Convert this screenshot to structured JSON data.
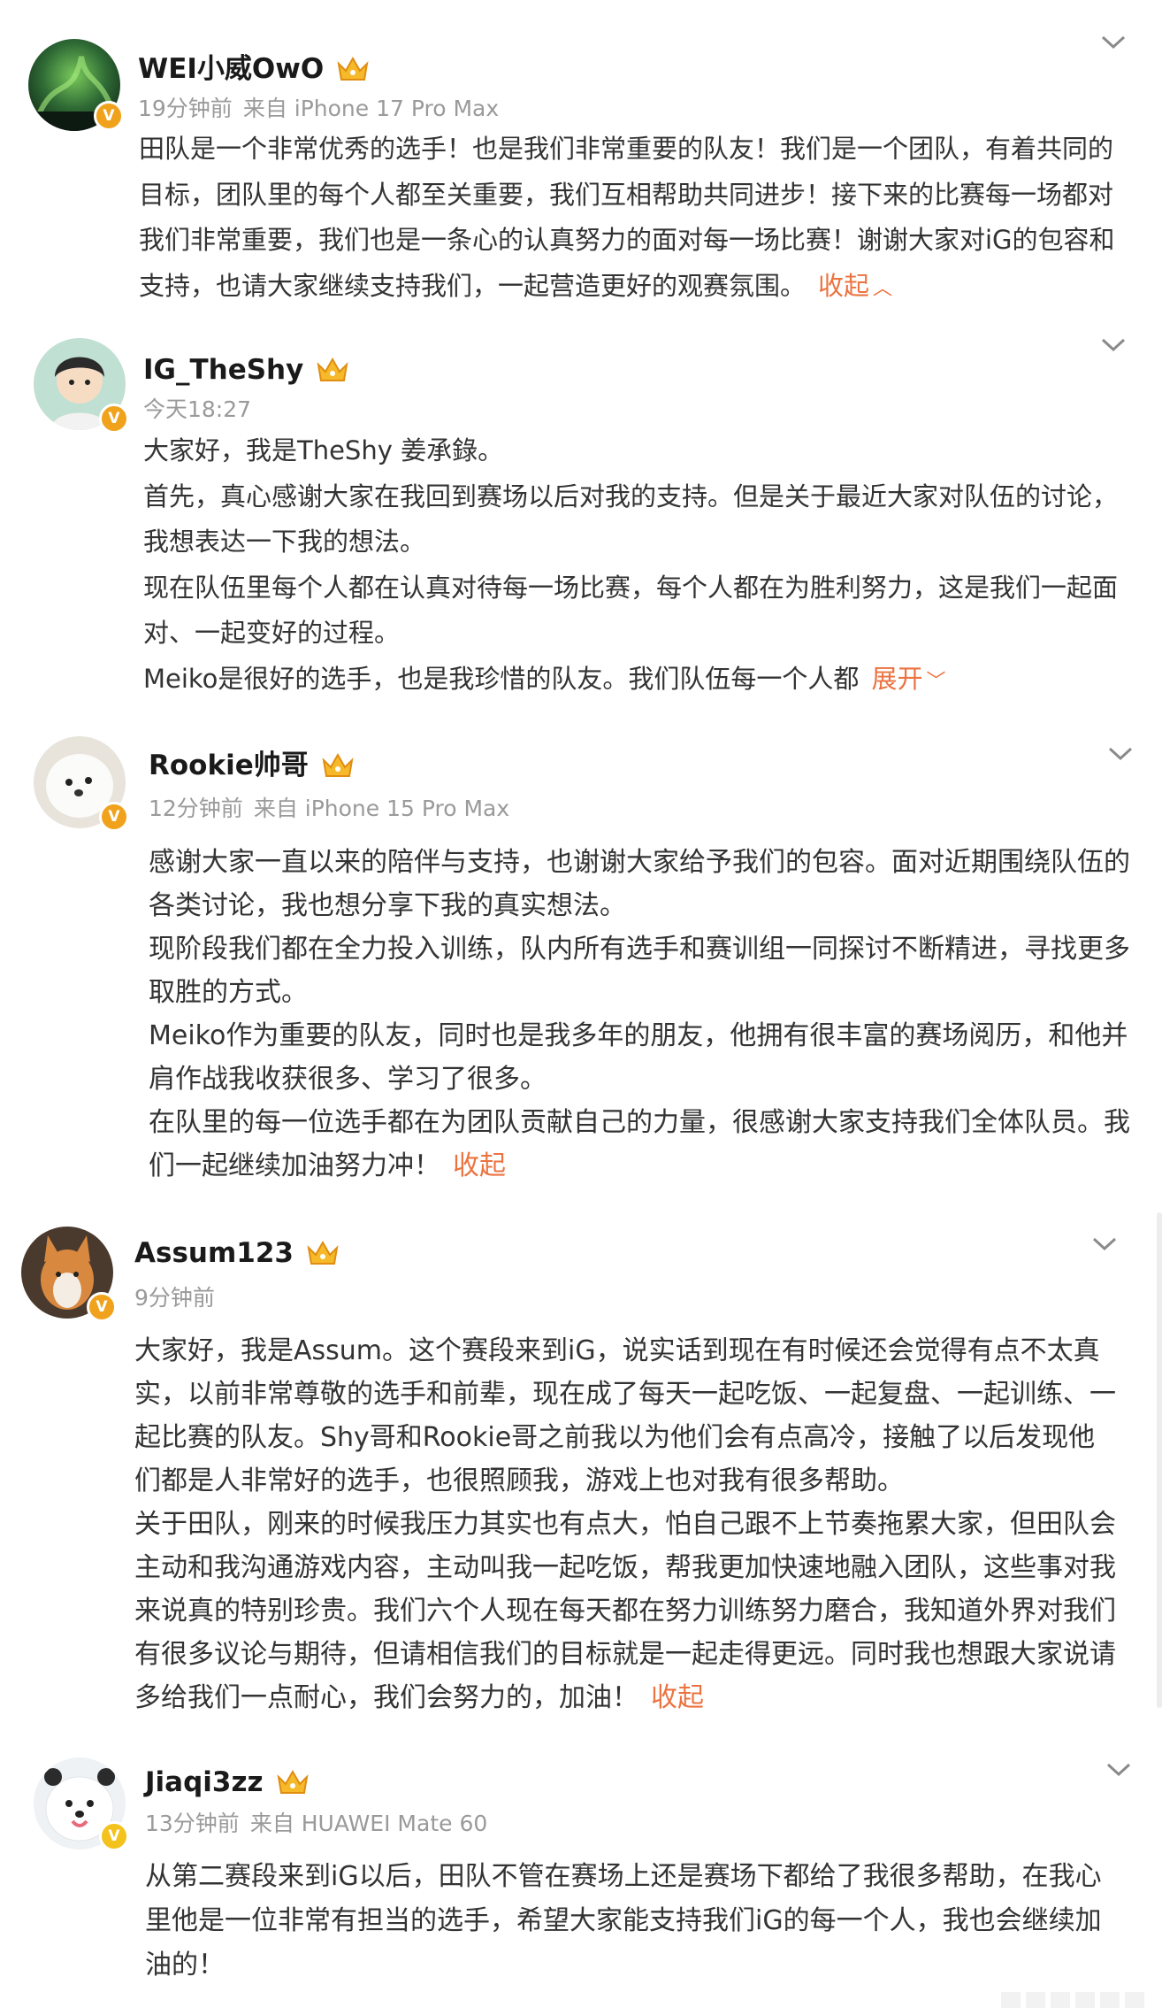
{
  "posts": [
    {
      "name": "WEI小威OwO",
      "time": "19分钟前",
      "source": "来自 iPhone 17 Pro Max",
      "paragraphs": [
        "田队是一个非常优秀的选手！也是我们非常重要的队友！我们是一个团队，有着共同的目标，团队里的每个人都至关重要，我们互相帮助共同进步！接下来的比赛每一场都对我们非常重要，我们也是一条心的认真努力的面对每一场比赛！谢谢大家对iG的包容和支持，也请大家继续支持我们，一起营造更好的观赛氛围。"
      ],
      "toggle": "收起",
      "toggle_icon": "chevron-up"
    },
    {
      "name": "IG_TheShy",
      "time": "今天18:27",
      "source": "",
      "paragraphs": [
        "大家好，我是TheShy 姜承錄。",
        "首先，真心感谢大家在我回到赛场以后对我的支持。但是关于最近大家对队伍的讨论，我想表达一下我的想法。",
        "现在队伍里每个人都在认真对待每一场比赛，每个人都在为胜利努力，这是我们一起面对、一起变好的过程。",
        "Meiko是很好的选手，也是我珍惜的队友。我们队伍每一个人都"
      ],
      "toggle": "展开",
      "toggle_icon": "chevron-down"
    },
    {
      "name": "Rookie帅哥",
      "time": "12分钟前",
      "source": "来自 iPhone 15 Pro Max",
      "paragraphs": [
        "感谢大家一直以来的陪伴与支持，也谢谢大家给予我们的包容。面对近期围绕队伍的各类讨论，我也想分享下我的真实想法。",
        "现阶段我们都在全力投入训练，队内所有选手和赛训组一同探讨不断精进，寻找更多取胜的方式。",
        "Meiko作为重要的队友，同时也是我多年的朋友，他拥有很丰富的赛场阅历，和他并肩作战我收获很多、学习了很多。",
        "在队里的每一位选手都在为团队贡献自己的力量，很感谢大家支持我们全体队员。我们一起继续加油努力冲！"
      ],
      "toggle": "收起",
      "toggle_icon": ""
    },
    {
      "name": "Assum123",
      "time": "9分钟前",
      "source": "",
      "paragraphs": [
        "大家好，我是Assum。这个赛段来到iG，说实话到现在有时候还会觉得有点不太真实，以前非常尊敬的选手和前辈，现在成了每天一起吃饭、一起复盘、一起训练、一起比赛的队友。Shy哥和Rookie哥之前我以为他们会有点高冷，接触了以后发现他们都是人非常好的选手，也很照顾我，游戏上也对我有很多帮助。",
        "关于田队，刚来的时候我压力其实也有点大，怕自己跟不上节奏拖累大家，但田队会主动和我沟通游戏内容，主动叫我一起吃饭，帮我更加快速地融入团队，这些事对我来说真的特别珍贵。我们六个人现在每天都在努力训练努力磨合，我知道外界对我们有很多议论与期待，但请相信我们的目标就是一起走得更远。同时我也想跟大家说请多给我们一点耐心，我们会努力的，加油！"
      ],
      "toggle": "收起",
      "toggle_icon": ""
    },
    {
      "name": "Jiaqi3zz",
      "time": "13分钟前",
      "source": "来自 HUAWEI Mate 60",
      "paragraphs": [
        "从第二赛段来到iG以后，田队不管在赛场上还是赛场下都给了我很多帮助，在我心里他是一位非常有担当的选手，希望大家能支持我们iG的每一个人，我也会继续加油的！"
      ],
      "toggle": "",
      "toggle_icon": ""
    }
  ],
  "icons": {
    "verified": "V",
    "verified_color": "#f0a21c",
    "link_color": "#eb7340",
    "crown": "crown-icon",
    "more": "chevron-down-icon"
  }
}
